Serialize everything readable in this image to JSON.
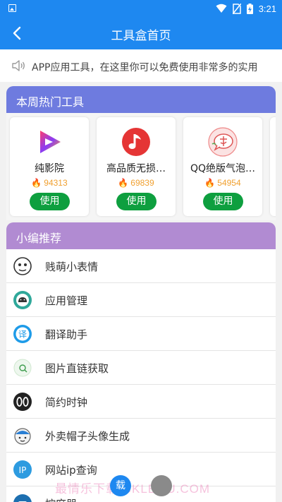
{
  "status_bar": {
    "time": "3:21",
    "icons": [
      "image-icon",
      "wifi-icon",
      "no-sim-icon",
      "battery-charging-icon"
    ]
  },
  "title_bar": {
    "title": "工具盒首页",
    "back_icon": "chevron-left-icon"
  },
  "notice": {
    "icon": "speaker-icon",
    "text": "APP应用工具，在这里你可以免费使用非常多的实用"
  },
  "hot_tools": {
    "header": "本周热门工具",
    "header_color": "#6e7bdf",
    "items": [
      {
        "name": "纯影院",
        "count": "94313",
        "button": "使用",
        "icon": "play-logo-icon"
      },
      {
        "name": "高品质无损…",
        "count": "69839",
        "button": "使用",
        "icon": "music-note-logo-icon"
      },
      {
        "name": "QQ绝版气泡…",
        "count": "54954",
        "button": "使用",
        "icon": "bubble-logo-icon"
      }
    ]
  },
  "recommend": {
    "header": "小编推荐",
    "header_color": "#b18bd2",
    "items": [
      {
        "label": "贱萌小表情",
        "icon": "meme-face-icon"
      },
      {
        "label": "应用管理",
        "icon": "android-icon"
      },
      {
        "label": "翻译助手",
        "icon": "translate-icon"
      },
      {
        "label": "图片直链获取",
        "icon": "image-link-icon"
      },
      {
        "label": "简约时钟",
        "icon": "clock-icon"
      },
      {
        "label": "外卖帽子头像生成",
        "icon": "avatar-hat-icon"
      },
      {
        "label": "网站ip查询",
        "icon": "ip-icon"
      },
      {
        "label": "控麻器",
        "icon": "tool-icon"
      }
    ]
  },
  "bottom": {
    "watermark": "最情乐下载 CKLEOU.COM",
    "fab_label": "载"
  },
  "colors": {
    "primary": "#1e88f0",
    "use_button": "#0e9f3f",
    "count_orange": "#f0a030"
  }
}
